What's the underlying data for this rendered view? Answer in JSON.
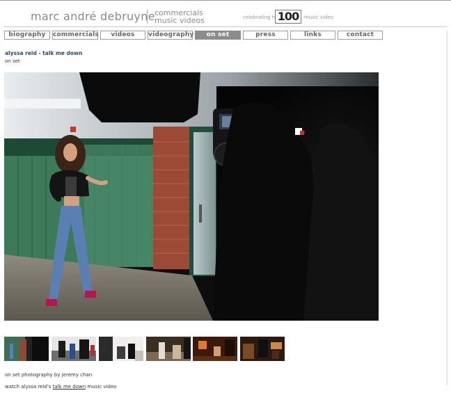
{
  "header": {
    "brand": "marc andré debruyne",
    "tagline_line1": "commercials",
    "tagline_line2": "music videos",
    "celebrating": "celebrating his",
    "badge": "100",
    "badge_suffix": "music video"
  },
  "nav": {
    "items": [
      {
        "label": "biography"
      },
      {
        "label": "commercials"
      },
      {
        "label": "videos"
      },
      {
        "label": "videography"
      },
      {
        "label": "on set"
      },
      {
        "label": "press"
      },
      {
        "label": "links"
      },
      {
        "label": "contact"
      }
    ],
    "active_index": 4
  },
  "content": {
    "title": "alyssa reid - talk me down",
    "subtitle": "on set",
    "credit": "on set photography by jeremy chan",
    "watch_prefix": "watch alyssa reid's",
    "watch_link": "talk me down",
    "watch_suffix": "music video"
  },
  "colors": {
    "title_blue": "#2b4a6e",
    "nav_active_bg": "#8c8c8c",
    "nav_border": "#9c9c9c",
    "header_gray": "#8a8a8a"
  }
}
